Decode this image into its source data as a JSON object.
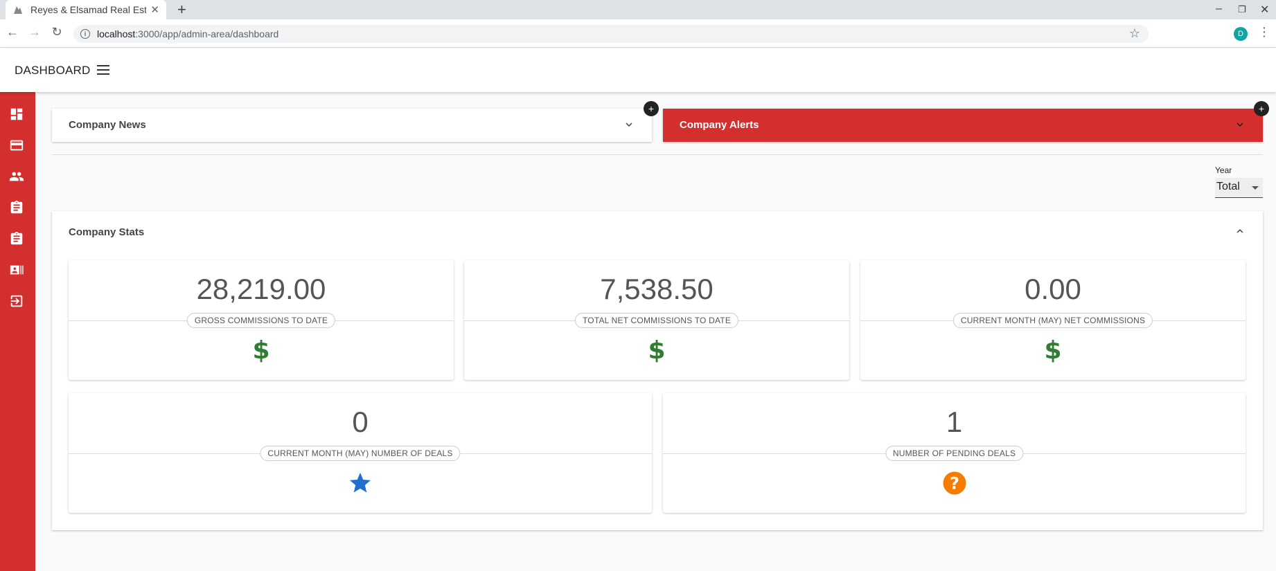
{
  "browser": {
    "tab_title": "Reyes & Elsamad Real Estate",
    "url_host": "localhost",
    "url_path": ":3000/app/admin-area/dashboard",
    "profile_initial": "D"
  },
  "header": {
    "title": "DASHBOARD"
  },
  "sidebar": {
    "items": [
      {
        "icon": "dashboard-icon"
      },
      {
        "icon": "credit-card-icon"
      },
      {
        "icon": "people-icon"
      },
      {
        "icon": "assignment-icon"
      },
      {
        "icon": "assignment-alt-icon"
      },
      {
        "icon": "contacts-icon"
      },
      {
        "icon": "logout-icon"
      }
    ]
  },
  "news": {
    "title": "Company News"
  },
  "alerts": {
    "title": "Company Alerts",
    "color": "#d32f2f"
  },
  "year_filter": {
    "label": "Year",
    "value": "Total"
  },
  "stats": {
    "title": "Company Stats",
    "cards": [
      {
        "value": "28,219.00",
        "label": "GROSS COMMISSIONS TO DATE",
        "icon": "dollar-icon",
        "icon_color": "#2e7d32"
      },
      {
        "value": "7,538.50",
        "label": "TOTAL NET COMMISSIONS TO DATE",
        "icon": "dollar-icon",
        "icon_color": "#2e7d32"
      },
      {
        "value": "0.00",
        "label": "CURRENT MONTH (MAY) NET COMMISSIONS",
        "icon": "dollar-icon",
        "icon_color": "#2e7d32"
      },
      {
        "value": "0",
        "label": "CURRENT MONTH (MAY) NUMBER OF DEALS",
        "icon": "star-icon",
        "icon_color": "#1e6fd0"
      },
      {
        "value": "1",
        "label": "NUMBER OF PENDING DEALS",
        "icon": "help-icon",
        "icon_color": "#f57c00"
      }
    ]
  }
}
